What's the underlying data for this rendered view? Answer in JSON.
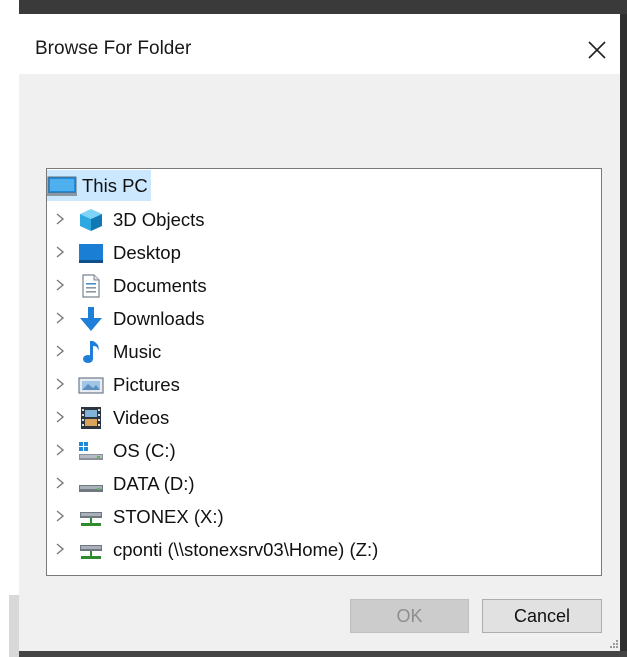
{
  "dialog": {
    "title": "Browse For Folder",
    "close_icon": "close-icon"
  },
  "tree": {
    "root": {
      "label": "This PC",
      "icon": "this-pc-icon",
      "selected": true
    },
    "items": [
      {
        "label": "3D Objects",
        "icon": "3d-objects-icon"
      },
      {
        "label": "Desktop",
        "icon": "desktop-icon"
      },
      {
        "label": "Documents",
        "icon": "documents-icon"
      },
      {
        "label": "Downloads",
        "icon": "downloads-icon"
      },
      {
        "label": "Music",
        "icon": "music-icon"
      },
      {
        "label": "Pictures",
        "icon": "pictures-icon"
      },
      {
        "label": "Videos",
        "icon": "videos-icon"
      },
      {
        "label": "OS (C:)",
        "icon": "windows-drive-icon"
      },
      {
        "label": "DATA (D:)",
        "icon": "drive-icon"
      },
      {
        "label": "STONEX (X:)",
        "icon": "network-drive-icon"
      },
      {
        "label": "cponti (\\\\stonexsrv03\\Home) (Z:)",
        "icon": "network-drive-icon"
      }
    ]
  },
  "buttons": {
    "ok_label": "OK",
    "ok_enabled": false,
    "cancel_label": "Cancel"
  },
  "colors": {
    "selection": "#cce8ff",
    "accent_blue": "#0078d7"
  }
}
